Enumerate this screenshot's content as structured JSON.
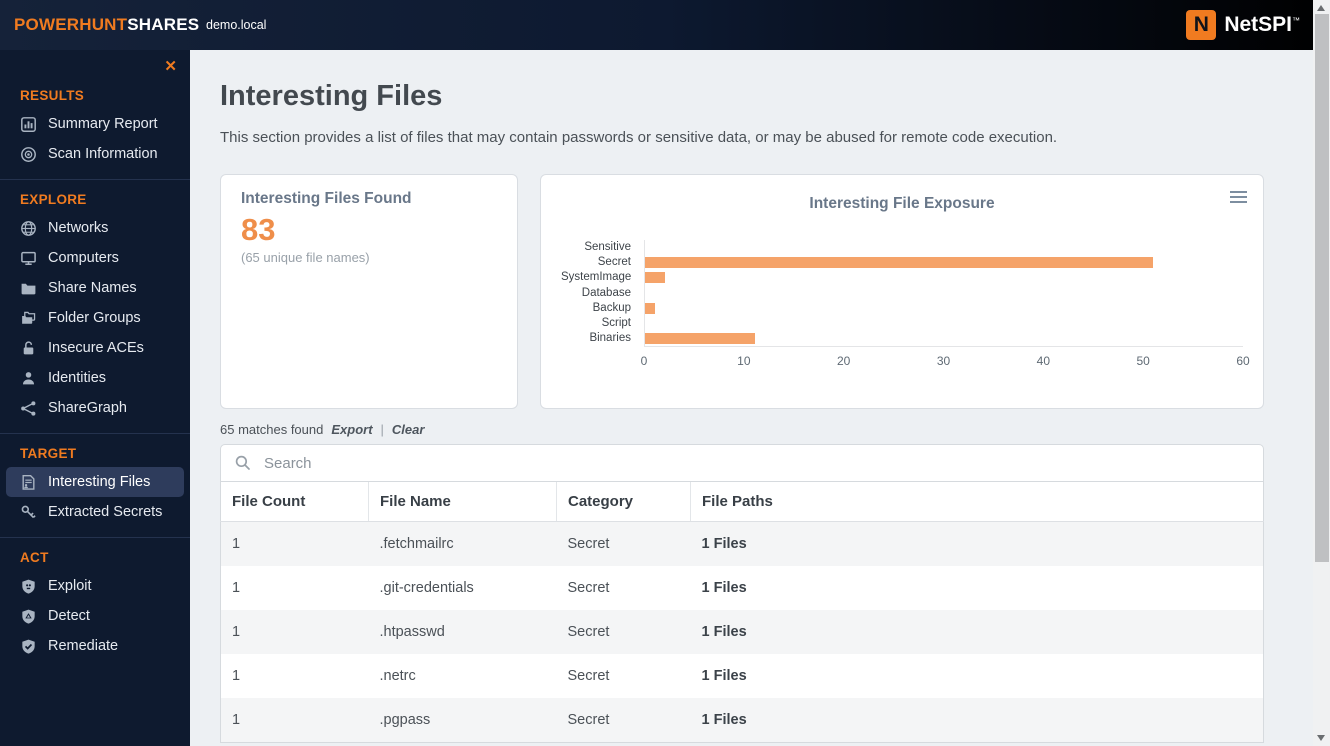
{
  "header": {
    "brand_primary": "POWERHUNT",
    "brand_secondary": "SHARES",
    "domain": "demo.local",
    "logo_letter": "N",
    "logo_text": "NetSPI",
    "logo_tm": "™"
  },
  "sidebar": {
    "close_glyph": "✕",
    "sections": [
      {
        "title": "RESULTS",
        "items": [
          {
            "label": "Summary Report",
            "icon": "bar-chart-icon"
          },
          {
            "label": "Scan Information",
            "icon": "radar-icon"
          }
        ]
      },
      {
        "title": "EXPLORE",
        "items": [
          {
            "label": "Networks",
            "icon": "globe-icon"
          },
          {
            "label": "Computers",
            "icon": "monitor-icon"
          },
          {
            "label": "Share Names",
            "icon": "folder-icon"
          },
          {
            "label": "Folder Groups",
            "icon": "folders-icon"
          },
          {
            "label": "Insecure ACEs",
            "icon": "unlock-icon"
          },
          {
            "label": "Identities",
            "icon": "person-icon"
          },
          {
            "label": "ShareGraph",
            "icon": "share-graph-icon"
          }
        ]
      },
      {
        "title": "TARGET",
        "items": [
          {
            "label": "Interesting Files",
            "icon": "interesting-files-icon",
            "active": true
          },
          {
            "label": "Extracted Secrets",
            "icon": "keys-icon"
          }
        ]
      },
      {
        "title": "ACT",
        "items": [
          {
            "label": "Exploit",
            "icon": "shield-skull-icon"
          },
          {
            "label": "Detect",
            "icon": "shield-alert-icon"
          },
          {
            "label": "Remediate",
            "icon": "shield-check-icon"
          }
        ]
      }
    ]
  },
  "main": {
    "title": "Interesting Files",
    "description": "This section provides a list of files that may contain passwords or sensitive data, or may be abused for remote code execution.",
    "summary_card": {
      "title": "Interesting Files Found",
      "count": "83",
      "subtitle": "(65 unique file names)"
    },
    "results_bar": {
      "matches": "65 matches found",
      "export_label": "Export",
      "separator": "|",
      "clear_label": "Clear"
    },
    "search": {
      "placeholder": "Search"
    },
    "table": {
      "columns": [
        "File Count",
        "File Name",
        "Category",
        "File Paths"
      ],
      "rows": [
        [
          "1",
          ".fetchmailrc",
          "Secret",
          "1 Files"
        ],
        [
          "1",
          ".git-credentials",
          "Secret",
          "1 Files"
        ],
        [
          "1",
          ".htpasswd",
          "Secret",
          "1 Files"
        ],
        [
          "1",
          ".netrc",
          "Secret",
          "1 Files"
        ],
        [
          "1",
          ".pgpass",
          "Secret",
          "1 Files"
        ]
      ]
    }
  },
  "chart_data": {
    "type": "bar",
    "orientation": "horizontal",
    "title": "Interesting File Exposure",
    "categories": [
      "Sensitive",
      "Secret",
      "SystemImage",
      "Database",
      "Backup",
      "Script",
      "Binaries"
    ],
    "values": [
      0,
      51,
      2,
      0,
      1,
      0,
      11
    ],
    "xlim": [
      0,
      60
    ],
    "x_ticks": [
      0,
      10,
      20,
      30,
      40,
      50,
      60
    ],
    "bar_color": "#f5a369",
    "grid": false,
    "legend": "none"
  },
  "colors": {
    "accent_orange": "#f07b20",
    "count_orange": "#ef8e4a",
    "bar_orange": "#f5a369",
    "sidebar_bg": "#0e1a2f",
    "active_item_bg": "#2e3c5c"
  }
}
